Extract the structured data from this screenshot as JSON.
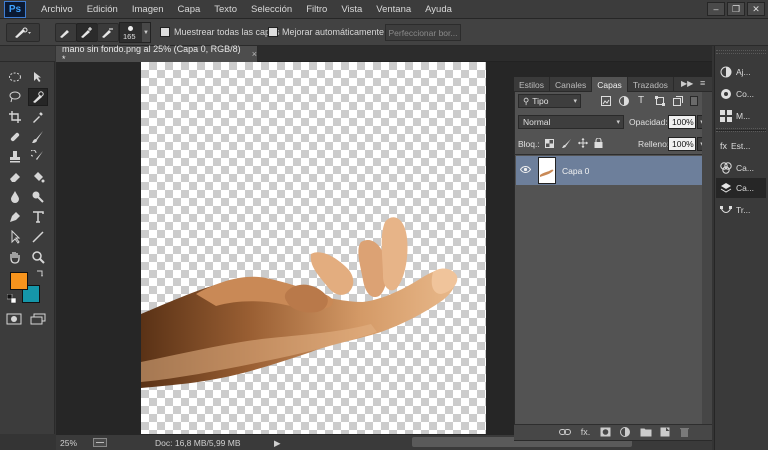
{
  "app": {
    "logo": "Ps",
    "menu": [
      "Archivo",
      "Edición",
      "Imagen",
      "Capa",
      "Texto",
      "Selección",
      "Filtro",
      "Vista",
      "Ventana",
      "Ayuda"
    ],
    "window_buttons": [
      "–",
      "❐",
      "✕"
    ]
  },
  "options_bar": {
    "brush_size": "165",
    "sample_all_layers": "Muestrear todas las capas",
    "auto_enhance": "Mejorar automáticamente",
    "refine_edge": "Perfeccionar bor..."
  },
  "document": {
    "tab_title": "mano sin fondo.png al 25% (Capa 0, RGB/8) *",
    "close": "×"
  },
  "status": {
    "zoom": "25%",
    "doc_info": "Doc: 16,8 MB/5,99 MB",
    "arrow": "▶"
  },
  "layers_panel": {
    "tabs": [
      "Estilos",
      "Canales",
      "Capas",
      "Trazados"
    ],
    "active_tab": "Capas",
    "filter_kind": "Tipo",
    "blend_mode": "Normal",
    "opacity_label": "Opacidad:",
    "opacity_value": "100%",
    "lock_label": "Bloq.:",
    "fill_label": "Relleno:",
    "fill_value": "100%",
    "layers": [
      {
        "name": "Capa 0",
        "visible": true,
        "selected": true
      }
    ],
    "footer_fx": "fx."
  },
  "dock": {
    "items": [
      "Aj...",
      "Co...",
      "M...",
      "Est...",
      "Ca...",
      "Ca...",
      "Tr..."
    ],
    "active": "Ca..."
  },
  "colors": {
    "foreground": "#f7941d",
    "background": "#1596a9",
    "layer_selected": "#6d7f9b",
    "skin": "#d9965f"
  },
  "icons": {
    "tools": [
      "marquee-icon",
      "move-icon",
      "lasso-icon",
      "quick-selection-icon",
      "crop-icon",
      "eyedropper-icon",
      "healing-brush-icon",
      "brush-icon",
      "clone-stamp-icon",
      "history-brush-icon",
      "eraser-icon",
      "paint-bucket-icon",
      "blur-icon",
      "dodge-icon",
      "pen-icon",
      "type-icon",
      "path-selection-icon",
      "line-icon",
      "hand-icon",
      "zoom-icon"
    ]
  }
}
